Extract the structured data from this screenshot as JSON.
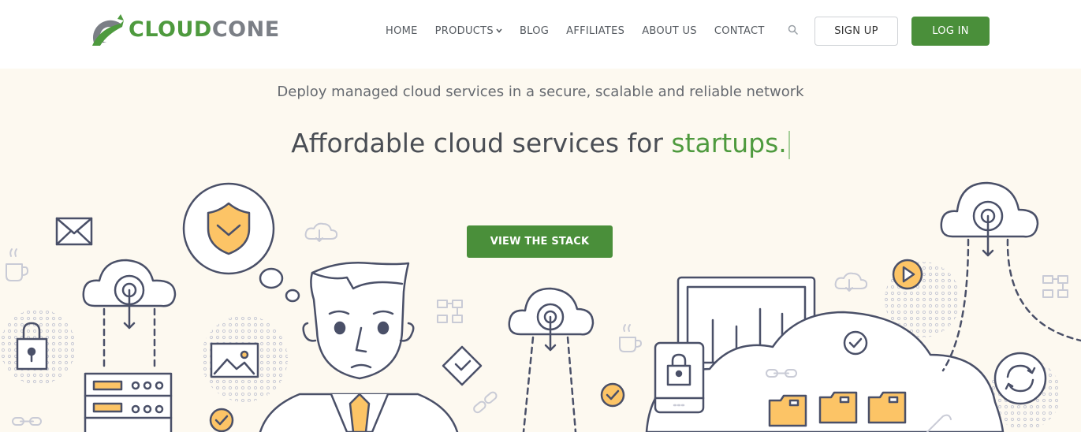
{
  "brand": {
    "name_part1": "CLOUD",
    "name_part2": "CONE",
    "logo_icon": "cloudcone-logo-icon",
    "colors": {
      "green": "#4e9a3e",
      "gray": "#7b7f86"
    }
  },
  "nav": {
    "items": [
      {
        "label": "HOME"
      },
      {
        "label": "PRODUCTS",
        "has_dropdown": true
      },
      {
        "label": "BLOG"
      },
      {
        "label": "AFFILIATES"
      },
      {
        "label": "ABOUT US"
      },
      {
        "label": "CONTACT"
      }
    ],
    "search_icon": "search-icon",
    "signup_label": "SIGN UP",
    "login_label": "LOG IN"
  },
  "hero": {
    "subtitle": "Deploy managed cloud services in a secure, scalable and reliable network",
    "title_prefix": "Affordable cloud services for ",
    "title_accent": "startups.",
    "cta_label": "VIEW THE STACK"
  },
  "colors": {
    "accent": "#4a8f3a",
    "background": "#fdf9f0",
    "illustration_line": "#4a5068",
    "illustration_fill": "#fcc466"
  }
}
